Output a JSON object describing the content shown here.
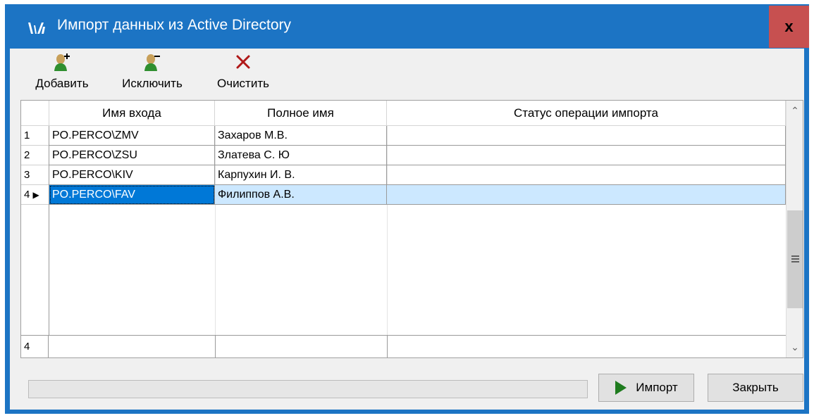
{
  "window": {
    "title": "Импорт данных из Active Directory",
    "close_label": "x"
  },
  "toolbar": {
    "add_label": "Добавить",
    "exclude_label": "Исключить",
    "clear_label": "Очистить"
  },
  "grid": {
    "columns": [
      "Имя входа",
      "Полное имя",
      "Статус операции импорта"
    ],
    "rows": [
      {
        "index": "1",
        "login": "PO.PERCO\\ZMV",
        "fullname": "Захаров М.В.",
        "status": ""
      },
      {
        "index": "2",
        "login": "PO.PERCO\\ZSU",
        "fullname": "Златева С. Ю",
        "status": ""
      },
      {
        "index": "3",
        "login": "PO.PERCO\\KIV",
        "fullname": "Карпухин И. В.",
        "status": ""
      },
      {
        "index": "4",
        "login": "PO.PERCO\\FAV",
        "fullname": "Филиппов А.В.",
        "status": ""
      }
    ],
    "selected_row": 4,
    "footer_count": "4"
  },
  "progress": {
    "value": 0
  },
  "buttons": {
    "import_label": "Импорт",
    "close_label": "Закрыть"
  },
  "colors": {
    "titlebar": "#1c74c4",
    "close": "#c75050",
    "selection": "#cce8ff",
    "focus": "#0078d7",
    "play_icon": "#1e7b1e"
  }
}
